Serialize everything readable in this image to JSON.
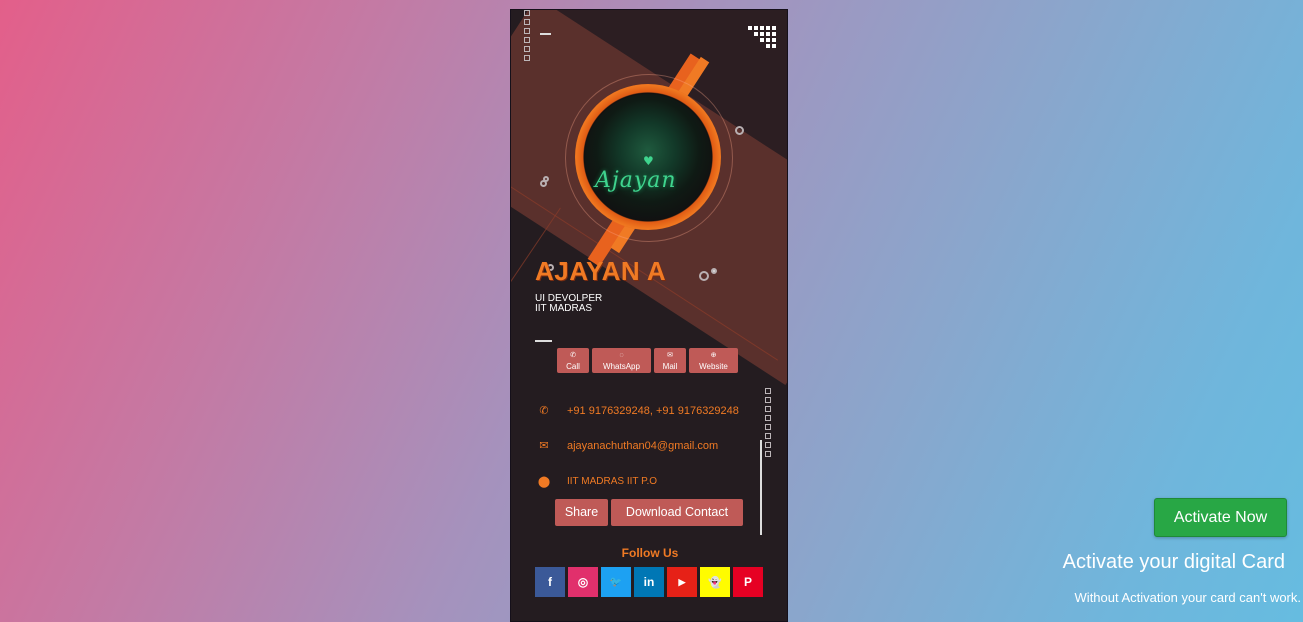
{
  "card": {
    "logo_text": "Ajayan",
    "name": "AJAYAN A",
    "role": "UI DEVOLPER",
    "org": "IIT MADRAS",
    "quick_actions": [
      {
        "label": "Call",
        "icon": "phone-icon"
      },
      {
        "label": "WhatsApp",
        "icon": "whatsapp-icon"
      },
      {
        "label": "Mail",
        "icon": "mail-icon"
      },
      {
        "label": "Website",
        "icon": "globe-icon"
      }
    ],
    "contact": {
      "phone": "+91 9176329248, +91 9176329248",
      "email": "ajayanachuthan04@gmail.com",
      "address": "IIT MADRAS IIT P.O"
    },
    "share_label": "Share",
    "download_label": "Download Contact",
    "follow_label": "Follow Us",
    "socials": [
      {
        "name": "facebook",
        "glyph": "f",
        "color": "#3b5998"
      },
      {
        "name": "instagram",
        "glyph": "◎",
        "color": "#e1306c"
      },
      {
        "name": "twitter",
        "glyph": "🐦",
        "color": "#1da1f2"
      },
      {
        "name": "linkedin",
        "glyph": "in",
        "color": "#0077b5"
      },
      {
        "name": "youtube",
        "glyph": "▶",
        "color": "#e62117"
      },
      {
        "name": "snapchat",
        "glyph": "👻",
        "color": "#fffc00"
      },
      {
        "name": "pinterest",
        "glyph": "P",
        "color": "#e60023"
      }
    ],
    "accent": "#f07a24",
    "button_color": "#bf5a57"
  },
  "activation": {
    "button_label": "Activate Now",
    "title": "Activate your digital Card",
    "subtitle": "Without Activation your card can't work.",
    "button_color": "#28a745"
  }
}
